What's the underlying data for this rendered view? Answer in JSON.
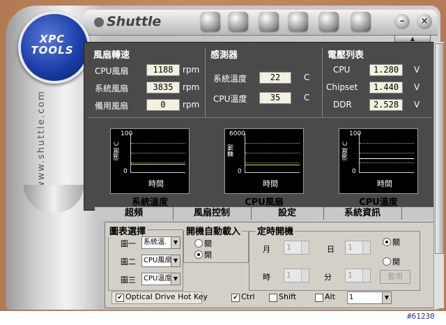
{
  "brand": "Shuttle",
  "logo_text": [
    "XPC",
    "TOOLS"
  ],
  "side_url": "www.shuttle.com",
  "fan_panel": {
    "title": "風扇轉速",
    "rows": [
      {
        "label": "CPU風扇",
        "value": "1188",
        "unit": "rpm"
      },
      {
        "label": "系統風扇",
        "value": "3835",
        "unit": "rpm"
      },
      {
        "label": "備用風扇",
        "value": "0",
        "unit": "rpm"
      }
    ]
  },
  "sensor_panel": {
    "title": "感測器",
    "rows": [
      {
        "label": "系統溫度",
        "value": "22",
        "unit": "C"
      },
      {
        "label": "CPU溫度",
        "value": "35",
        "unit": "C"
      }
    ]
  },
  "voltage_panel": {
    "title": "電壓列表",
    "rows": [
      {
        "label": "CPU",
        "value": "1.280",
        "unit": "V"
      },
      {
        "label": "Chipset",
        "value": "1.440",
        "unit": "V"
      },
      {
        "label": "DDR",
        "value": "2.528",
        "unit": "V"
      }
    ]
  },
  "graphs": [
    {
      "ylabel": "溫度 C",
      "ymax": "100",
      "ymin": "0",
      "xlabel": "時間",
      "caption": "系統溫度",
      "level": 0.22
    },
    {
      "ylabel": "轉速",
      "ymax": "6000",
      "ymin": "0",
      "xlabel": "時間",
      "caption": "CPU風扇",
      "level": 0.2
    },
    {
      "ylabel": "溫度 C",
      "ymax": "100",
      "ymin": "0",
      "xlabel": "時間",
      "caption": "CPU溫度",
      "level": 0.35
    }
  ],
  "tabs": [
    "超頻",
    "風扇控制",
    "設定",
    "系統資訊"
  ],
  "chart_select": {
    "title": "圖表選擇",
    "rows": [
      {
        "label": "圖一",
        "value": "系統溫."
      },
      {
        "label": "圖二",
        "value": "CPU風扇"
      },
      {
        "label": "圖三",
        "value": "CPU溫度"
      }
    ]
  },
  "autoload": {
    "title": "開機自動載入",
    "options": [
      {
        "label": "關",
        "selected": false
      },
      {
        "label": "開",
        "selected": true
      }
    ]
  },
  "timer": {
    "title": "定時開機",
    "month_label": "月",
    "month": "1",
    "day_label": "日",
    "day": "1",
    "hour_label": "時",
    "hour": "1",
    "minute_label": "分",
    "minute": "1",
    "off_label": "關",
    "on_label": "開",
    "apply_label": "套用"
  },
  "hotkey": {
    "optical_label": "Optical Drive Hot Key",
    "ctrl_label": "Ctrl",
    "shift_label": "Shift",
    "alt_label": "Alt",
    "key_value": "1"
  },
  "footer_id": "#61230"
}
